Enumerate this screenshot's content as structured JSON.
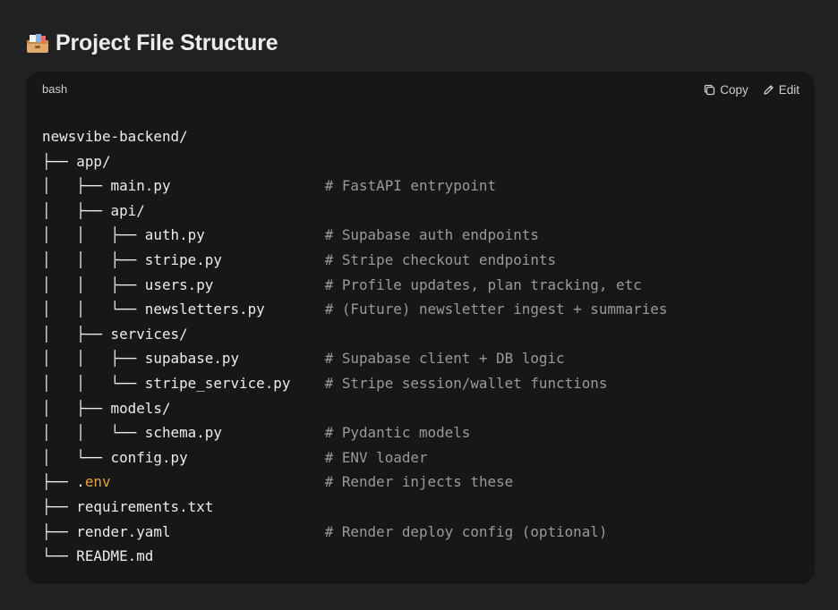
{
  "page": {
    "heading_icon": "card-file-box-icon",
    "heading_title": "Project File Structure"
  },
  "code_block": {
    "language": "bash",
    "copy_label": "Copy",
    "edit_label": "Edit",
    "lines": [
      {
        "prefix": "newsvibe-backend/",
        "highlight": "",
        "comment": ""
      },
      {
        "prefix": "├── app/",
        "highlight": "",
        "comment": ""
      },
      {
        "prefix": "│   ├── main.py                  ",
        "highlight": "",
        "comment": "# FastAPI entrypoint"
      },
      {
        "prefix": "│   ├── api/",
        "highlight": "",
        "comment": ""
      },
      {
        "prefix": "│   │   ├── auth.py              ",
        "highlight": "",
        "comment": "# Supabase auth endpoints"
      },
      {
        "prefix": "│   │   ├── stripe.py            ",
        "highlight": "",
        "comment": "# Stripe checkout endpoints"
      },
      {
        "prefix": "│   │   ├── users.py             ",
        "highlight": "",
        "comment": "# Profile updates, plan tracking, etc"
      },
      {
        "prefix": "│   │   └── newsletters.py       ",
        "highlight": "",
        "comment": "# (Future) newsletter ingest + summaries"
      },
      {
        "prefix": "│   ├── services/",
        "highlight": "",
        "comment": ""
      },
      {
        "prefix": "│   │   ├── supabase.py          ",
        "highlight": "",
        "comment": "# Supabase client + DB logic"
      },
      {
        "prefix": "│   │   └── stripe_service.py    ",
        "highlight": "",
        "comment": "# Stripe session/wallet functions"
      },
      {
        "prefix": "│   ├── models/",
        "highlight": "",
        "comment": ""
      },
      {
        "prefix": "│   │   └── schema.py            ",
        "highlight": "",
        "comment": "# Pydantic models"
      },
      {
        "prefix": "│   └── config.py                ",
        "highlight": "",
        "comment": "# ENV loader"
      },
      {
        "prefix": "├── .",
        "highlight": "env",
        "suffix": "                         ",
        "comment": "# Render injects these"
      },
      {
        "prefix": "├── requirements.txt",
        "highlight": "",
        "comment": ""
      },
      {
        "prefix": "├── render.yaml                  ",
        "highlight": "",
        "comment": "# Render deploy config (optional)"
      },
      {
        "prefix": "└── README.md",
        "highlight": "",
        "comment": ""
      }
    ]
  },
  "colors": {
    "page_bg": "#212121",
    "card_bg": "#171717",
    "text": "#ececec",
    "comment": "#9a9a9a",
    "highlight": "#e9a23b"
  }
}
